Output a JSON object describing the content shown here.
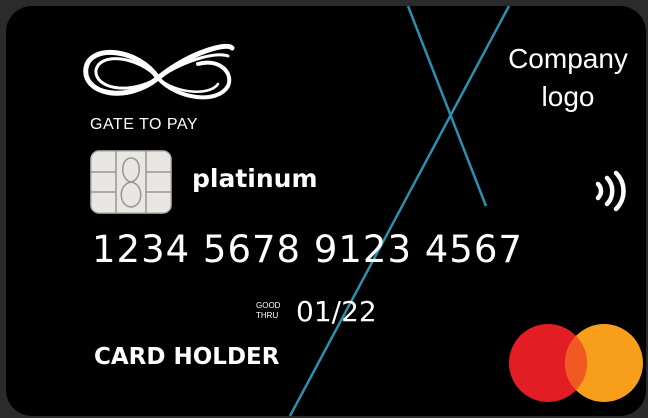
{
  "card": {
    "issuer_name": "GATE TO PAY",
    "company_logo_line1": "Company",
    "company_logo_line2": "logo",
    "tier": "platinum",
    "number": "1234 5678 9123 4567",
    "valid_label_line1": "GOOD",
    "valid_label_line2": "THRU",
    "expiry": "01/22",
    "holder": "CARD HOLDER"
  },
  "colors": {
    "card_background": "#000000",
    "accent_line": "#2a8fb0",
    "mastercard_red": "#e31d24",
    "mastercard_orange": "#f79e1b",
    "mastercard_overlap": "#f05a22"
  },
  "icons": {
    "issuer_logo": "infinity-loop-icon",
    "chip": "emv-chip-icon",
    "contactless": "contactless-icon",
    "network": "mastercard-icon"
  }
}
